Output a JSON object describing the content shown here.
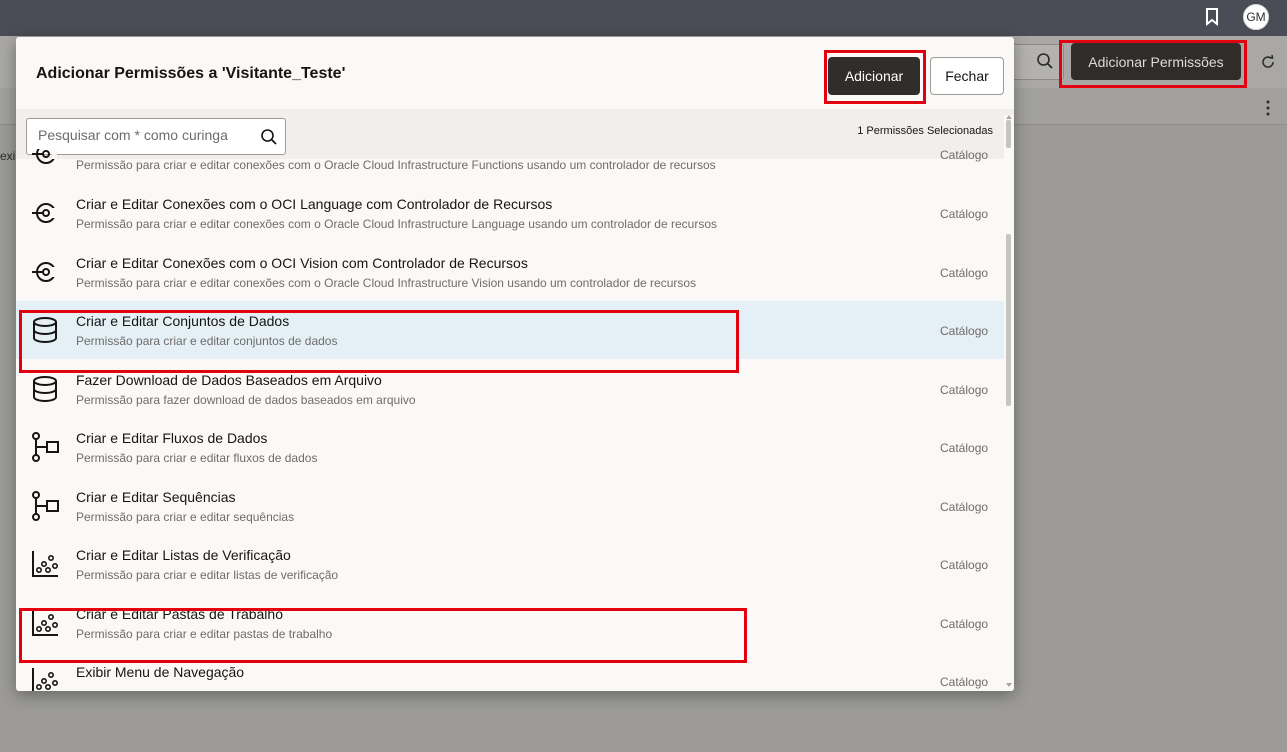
{
  "topbar": {
    "avatar_initials": "GM",
    "bookmark_icon": "bookmark-icon"
  },
  "background": {
    "add_permissions_label": "Adicionar Permissões",
    "fragment_text": "exi"
  },
  "modal": {
    "title": "Adicionar Permissões a 'Visitante_Teste'",
    "add_label": "Adicionar",
    "close_label": "Fechar",
    "search_placeholder": "Pesquisar com * como curinga",
    "selected_count": "1 Permissões Selecionadas",
    "items": [
      {
        "title": "",
        "desc": "Permissão para criar e editar conexões com o Oracle Cloud Infrastructure Functions usando um controlador de recursos",
        "category": "Catálogo",
        "icon": "connection-icon",
        "selected": false
      },
      {
        "title": "Criar e Editar Conexões com o OCI Language com Controlador de Recursos",
        "desc": "Permissão para criar e editar conexões com o Oracle Cloud Infrastructure Language usando um controlador de recursos",
        "category": "Catálogo",
        "icon": "connection-icon",
        "selected": false
      },
      {
        "title": "Criar e Editar Conexões com o OCI Vision com Controlador de Recursos",
        "desc": "Permissão para criar e editar conexões com o Oracle Cloud Infrastructure Vision usando um controlador de recursos",
        "category": "Catálogo",
        "icon": "connection-icon",
        "selected": false
      },
      {
        "title": "Criar e Editar Conjuntos de Dados",
        "desc": "Permissão para criar e editar conjuntos de dados",
        "category": "Catálogo",
        "icon": "database-icon",
        "selected": true
      },
      {
        "title": "Fazer Download de Dados Baseados em Arquivo",
        "desc": "Permissão para fazer download de dados baseados em arquivo",
        "category": "Catálogo",
        "icon": "database-icon",
        "selected": false
      },
      {
        "title": "Criar e Editar Fluxos de Dados",
        "desc": "Permissão para criar e editar fluxos de dados",
        "category": "Catálogo",
        "icon": "dataflow-icon",
        "selected": false
      },
      {
        "title": "Criar e Editar Sequências",
        "desc": "Permissão para criar e editar sequências",
        "category": "Catálogo",
        "icon": "dataflow-icon",
        "selected": false
      },
      {
        "title": "Criar e Editar Listas de Verificação",
        "desc": "Permissão para criar e editar listas de verificação",
        "category": "Catálogo",
        "icon": "scatter-chart-icon",
        "selected": false
      },
      {
        "title": "Criar e Editar Pastas de Trabalho",
        "desc": "Permissão para criar e editar pastas de trabalho",
        "category": "Catálogo",
        "icon": "scatter-chart-icon",
        "selected": false
      },
      {
        "title": "Exibir Menu de Navegação",
        "desc": "",
        "category": "Catálogo",
        "icon": "scatter-chart-icon",
        "selected": false
      }
    ]
  },
  "colors": {
    "highlight": "#e3000f",
    "primary_button": "#312d2a",
    "selected_row": "#e4eff6"
  }
}
